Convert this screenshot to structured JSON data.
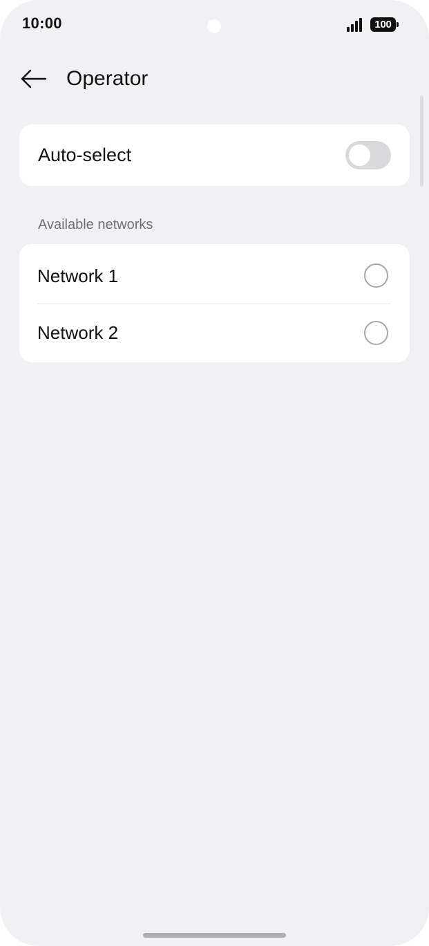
{
  "status_bar": {
    "time": "10:00",
    "battery_level": "100",
    "signal_icon": "signal-bars-icon"
  },
  "header": {
    "back_icon": "arrow-left-icon",
    "title": "Operator"
  },
  "auto_select": {
    "label": "Auto-select",
    "enabled": false
  },
  "networks_section": {
    "header": "Available networks",
    "items": [
      {
        "label": "Network 1",
        "selected": false
      },
      {
        "label": "Network 2",
        "selected": false
      }
    ]
  }
}
